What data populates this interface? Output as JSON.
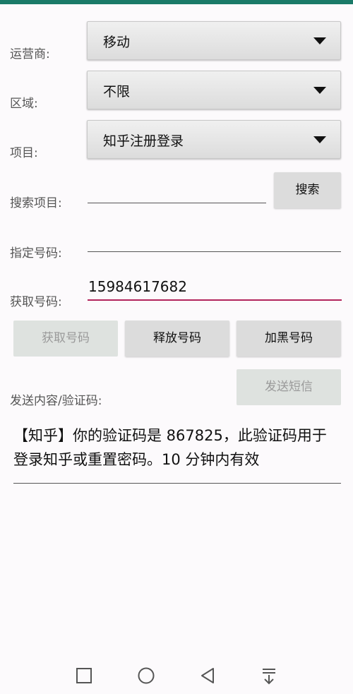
{
  "form": {
    "carrier": {
      "label": "运营商:",
      "value": "移动"
    },
    "region": {
      "label": "区域:",
      "value": "不限"
    },
    "project": {
      "label": "项目:",
      "value": "知乎注册登录"
    },
    "search_project": {
      "label": "搜索项目:",
      "value": "",
      "button": "搜索"
    },
    "specified_number": {
      "label": "指定号码:",
      "value": ""
    },
    "fetched_number": {
      "label": "获取号码:",
      "value": "15984617682"
    }
  },
  "actions": {
    "get_number": "获取号码",
    "release_number": "释放号码",
    "blacklist_number": "加黑号码"
  },
  "sms": {
    "label": "发送内容/验证码:",
    "send_button": "发送短信",
    "content": "【知乎】你的验证码是 867825，此验证码用于登录知乎或重置密码。10 分钟内有效"
  },
  "navbar": {
    "icons": [
      "square-icon",
      "circle-home-icon",
      "triangle-back-icon",
      "notification-pull-icon"
    ]
  },
  "colors": {
    "status_bar": "#1a7a68",
    "focus_underline": "#b2245c"
  }
}
